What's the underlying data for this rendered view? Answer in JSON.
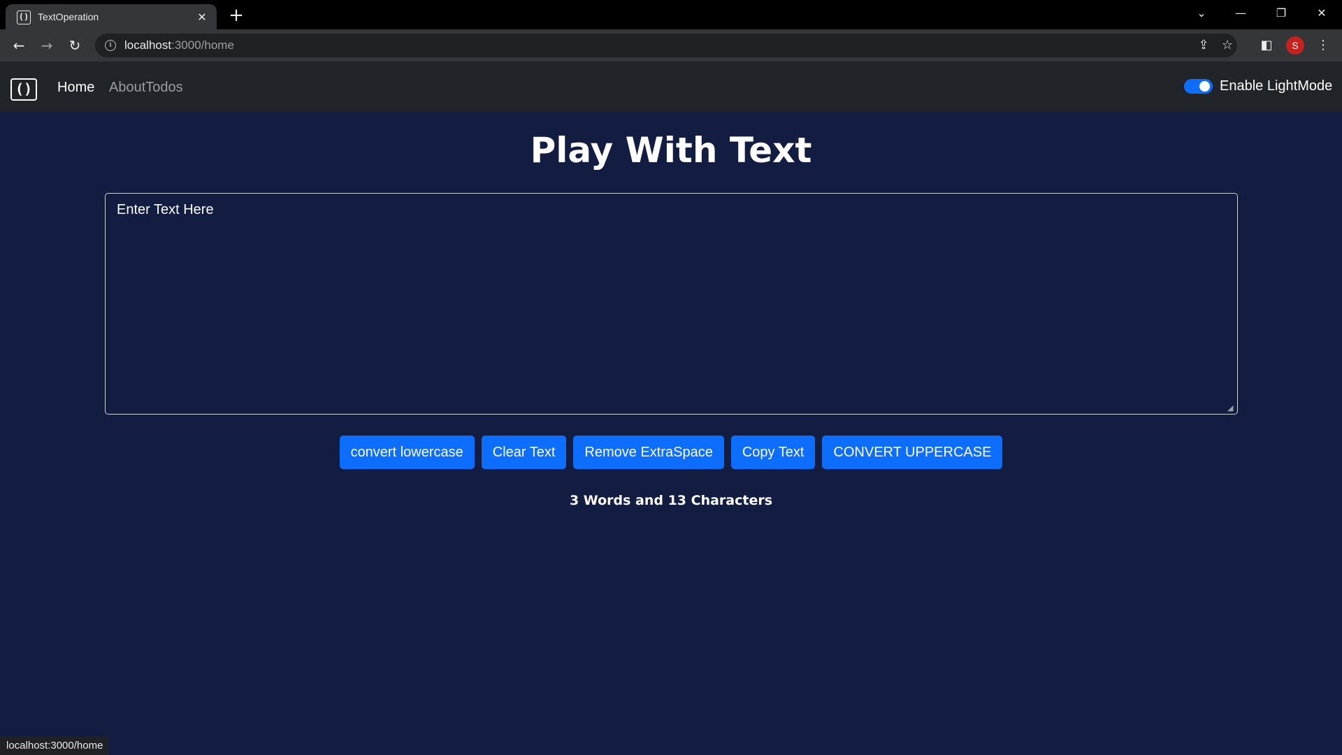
{
  "browser": {
    "tab_title": "TextOperation",
    "tab_close_glyph": "✕",
    "new_tab_glyph": "+",
    "url_host": "localhost",
    "url_rest": ":3000/home",
    "profile_initial": "S",
    "status_url": "localhost:3000/home"
  },
  "navbar": {
    "brand_glyph": "()",
    "links": [
      {
        "label": "Home",
        "active": true
      },
      {
        "label": "AboutTodos",
        "active": false
      }
    ],
    "switch_label": "Enable LightMode",
    "switch_on": true
  },
  "main": {
    "heading": "Play With Text",
    "textarea_placeholder": "Enter Text Here",
    "buttons": [
      {
        "label": "convert lowercase"
      },
      {
        "label": "Clear Text"
      },
      {
        "label": "Remove ExtraSpace"
      },
      {
        "label": "Copy Text"
      },
      {
        "label": "CONVERT UPPERCASE"
      }
    ],
    "summary": "3 Words and 13 Characters"
  },
  "colors": {
    "page_bg": "#131c41",
    "navbar_bg": "#212529",
    "button_bg": "#0d6efd",
    "text": "#ffffff"
  }
}
